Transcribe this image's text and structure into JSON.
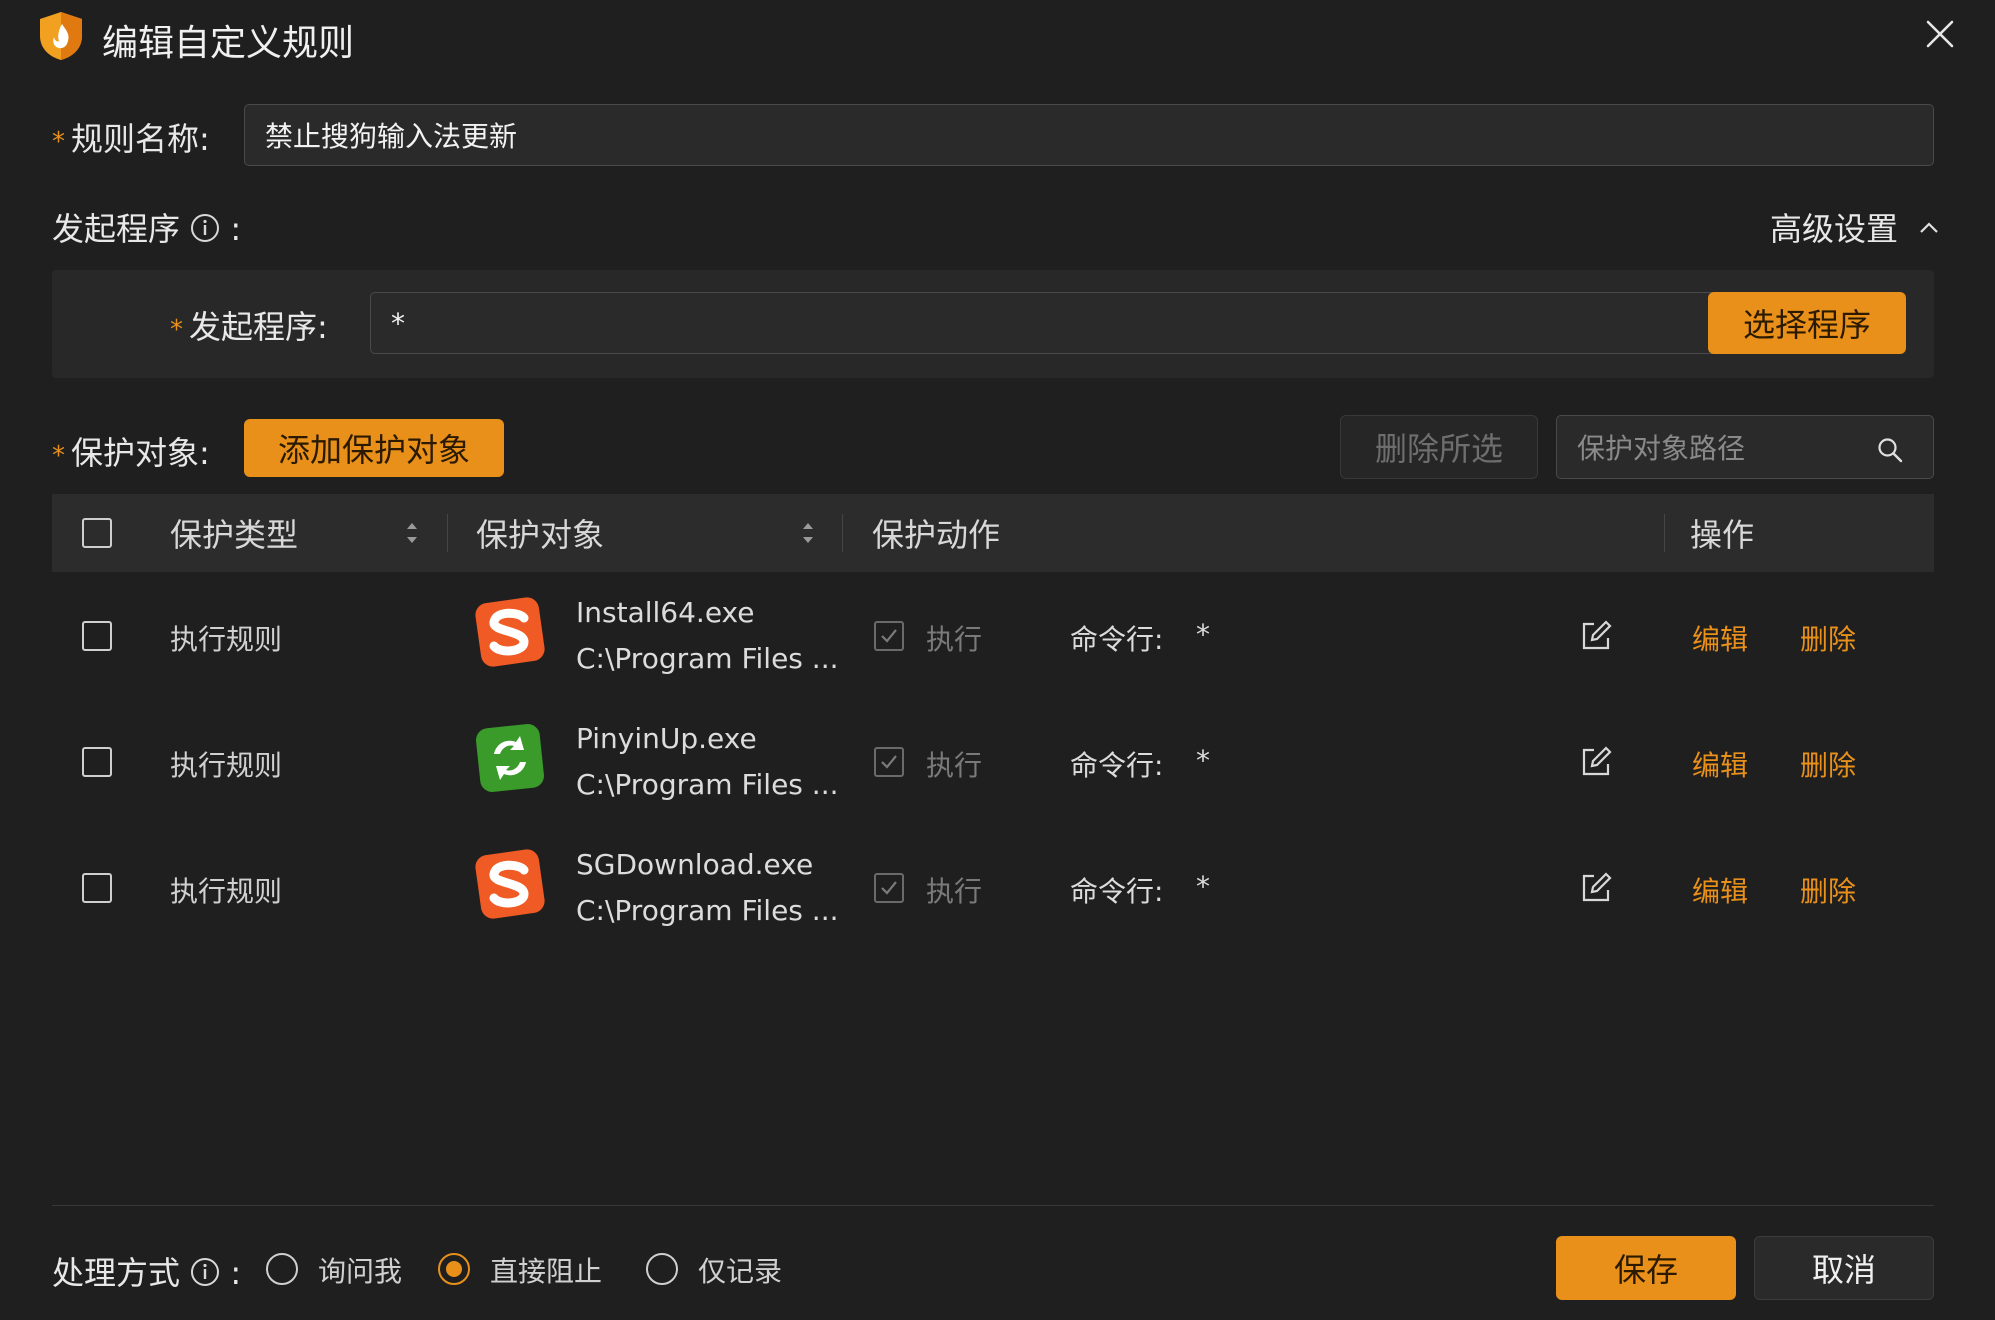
{
  "window": {
    "title": "编辑自定义规则"
  },
  "rule_name": {
    "required_mark": "*",
    "label": "规则名称:",
    "value": "禁止搜狗输入法更新"
  },
  "initiator": {
    "section_label": "发起程序",
    "colon": ":",
    "advanced_label": "高级设置",
    "required_mark": "*",
    "field_label": "发起程序:",
    "value": "*",
    "select_button": "选择程序"
  },
  "protect": {
    "required_mark": "*",
    "label": "保护对象:",
    "add_button": "添加保护对象",
    "delete_selected_button": "删除所选",
    "search_placeholder": "保护对象路径"
  },
  "table": {
    "columns": {
      "type": "保护类型",
      "object": "保护对象",
      "action": "保护动作",
      "ops": "操作"
    },
    "rows": [
      {
        "type": "执行规则",
        "icon": "sogou-s-icon",
        "name": "Install64.exe",
        "path": "C:\\Program Files ...",
        "action": "执行",
        "cmd_label": "命令行:",
        "cmd_value": "*",
        "edit": "编辑",
        "delete": "删除"
      },
      {
        "type": "执行规则",
        "icon": "pinyinup-refresh-icon",
        "name": "PinyinUp.exe",
        "path": "C:\\Program Files ...",
        "action": "执行",
        "cmd_label": "命令行:",
        "cmd_value": "*",
        "edit": "编辑",
        "delete": "删除"
      },
      {
        "type": "执行规则",
        "icon": "sogou-s-icon",
        "name": "SGDownload.exe",
        "path": "C:\\Program Files ...",
        "action": "执行",
        "cmd_label": "命令行:",
        "cmd_value": "*",
        "edit": "编辑",
        "delete": "删除"
      }
    ]
  },
  "handling": {
    "label": "处理方式",
    "colon": ":",
    "options": [
      "询问我",
      "直接阻止",
      "仅记录"
    ],
    "selected": "直接阻止"
  },
  "footer": {
    "save": "保存",
    "cancel": "取消"
  },
  "colors": {
    "accent": "#e8901a",
    "background": "#1f1f1f"
  }
}
